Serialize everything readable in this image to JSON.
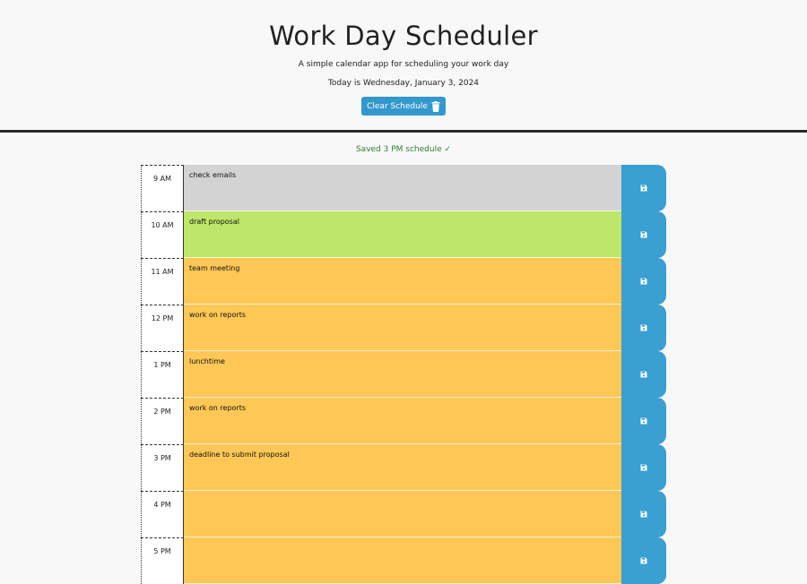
{
  "header": {
    "title": "Work Day Scheduler",
    "lead": "A simple calendar app for scheduling your work day",
    "today": "Today is Wednesday, January 3, 2024",
    "clear_label": "Clear Schedule"
  },
  "status": {
    "saved_message": "Saved 3 PM schedule ✓",
    "color": "#2e7d32"
  },
  "colors": {
    "past": "#d3d3d3",
    "present": "#bde66a",
    "future": "#fec756",
    "save_button": "#3a9fd1",
    "clear_button": "#3399cc"
  },
  "schedule": [
    {
      "hour": "9 AM",
      "text": "check emails",
      "state": "past"
    },
    {
      "hour": "10 AM",
      "text": "draft proposal",
      "state": "present"
    },
    {
      "hour": "11 AM",
      "text": "team meeting",
      "state": "future"
    },
    {
      "hour": "12 PM",
      "text": "work on reports",
      "state": "future"
    },
    {
      "hour": "1 PM",
      "text": "lunchtime",
      "state": "future"
    },
    {
      "hour": "2 PM",
      "text": "work on reports",
      "state": "future"
    },
    {
      "hour": "3 PM",
      "text": "deadline to submit proposal",
      "state": "future"
    },
    {
      "hour": "4 PM",
      "text": "",
      "state": "future"
    },
    {
      "hour": "5 PM",
      "text": "",
      "state": "future"
    }
  ],
  "icons": {
    "clear": "trash-icon",
    "save": "floppy-disk-icon"
  }
}
